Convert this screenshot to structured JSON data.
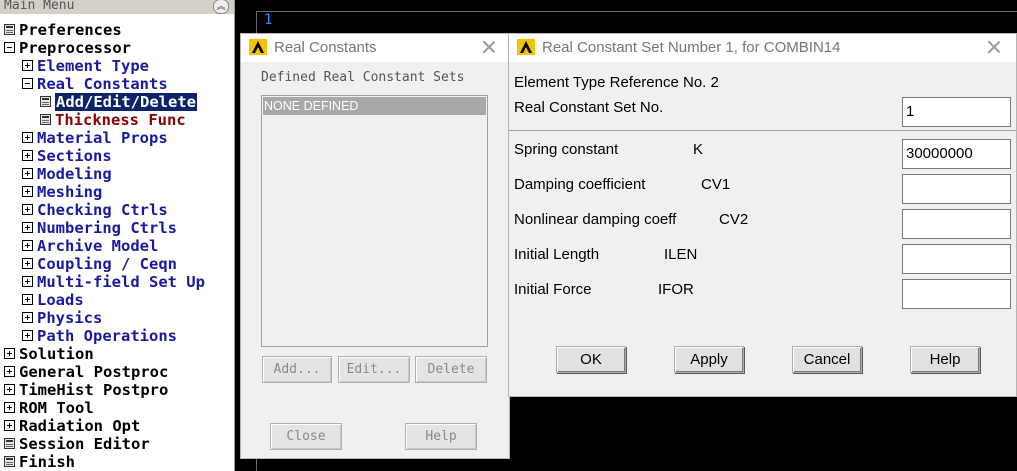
{
  "main_menu": {
    "title": "Main Menu",
    "items": [
      {
        "label": "Preferences",
        "icon": "doc"
      },
      {
        "label": "Preprocessor",
        "icon": "minus"
      },
      {
        "label": "Element Type",
        "icon": "plus"
      },
      {
        "label": "Real Constants",
        "icon": "minus"
      },
      {
        "label": "Add/Edit/Delete",
        "icon": "doc",
        "selected": true
      },
      {
        "label": "Thickness Func",
        "icon": "doc"
      },
      {
        "label": "Material Props",
        "icon": "plus"
      },
      {
        "label": "Sections",
        "icon": "plus"
      },
      {
        "label": "Modeling",
        "icon": "plus"
      },
      {
        "label": "Meshing",
        "icon": "plus"
      },
      {
        "label": "Checking Ctrls",
        "icon": "plus"
      },
      {
        "label": "Numbering Ctrls",
        "icon": "plus"
      },
      {
        "label": "Archive Model",
        "icon": "plus"
      },
      {
        "label": "Coupling / Ceqn",
        "icon": "plus"
      },
      {
        "label": "Multi-field Set Up",
        "icon": "plus"
      },
      {
        "label": "Loads",
        "icon": "plus"
      },
      {
        "label": "Physics",
        "icon": "plus"
      },
      {
        "label": "Path Operations",
        "icon": "plus"
      },
      {
        "label": "Solution",
        "icon": "plus"
      },
      {
        "label": "General Postproc",
        "icon": "plus"
      },
      {
        "label": "TimeHist Postpro",
        "icon": "plus"
      },
      {
        "label": "ROM Tool",
        "icon": "plus"
      },
      {
        "label": "Radiation Opt",
        "icon": "plus"
      },
      {
        "label": "Session Editor",
        "icon": "doc"
      },
      {
        "label": "Finish",
        "icon": "doc"
      }
    ]
  },
  "graphics": {
    "window_number": "1"
  },
  "real_constants_dialog": {
    "title": "Real Constants",
    "caption": "Defined Real Constant Sets",
    "list_items": [
      "NONE DEFINED"
    ],
    "buttons": {
      "add": "Add...",
      "edit": "Edit...",
      "delete": "Delete",
      "close": "Close",
      "help": "Help"
    }
  },
  "set_dialog": {
    "title": "Real Constant Set Number 1, for COMBIN14",
    "element_type_ref": "Element Type Reference No. 2",
    "set_no_label": "Real Constant Set No.",
    "set_no_value": "1",
    "fields": [
      {
        "label": "Spring constant",
        "key": "K",
        "value": "30000000"
      },
      {
        "label": "Damping coefficient",
        "key": "CV1",
        "value": ""
      },
      {
        "label": "Nonlinear damping coeff",
        "key": "CV2",
        "value": ""
      },
      {
        "label": "Initial Length",
        "key": "ILEN",
        "value": ""
      },
      {
        "label": "Initial Force",
        "key": "IFOR",
        "value": ""
      }
    ],
    "buttons": {
      "ok": "OK",
      "apply": "Apply",
      "cancel": "Cancel",
      "help": "Help"
    }
  },
  "colors": {
    "selection": "#0a246a",
    "graphics_bg": "#000000",
    "ansys_logo": "#f5c400",
    "window_number": "#2a8cff"
  }
}
